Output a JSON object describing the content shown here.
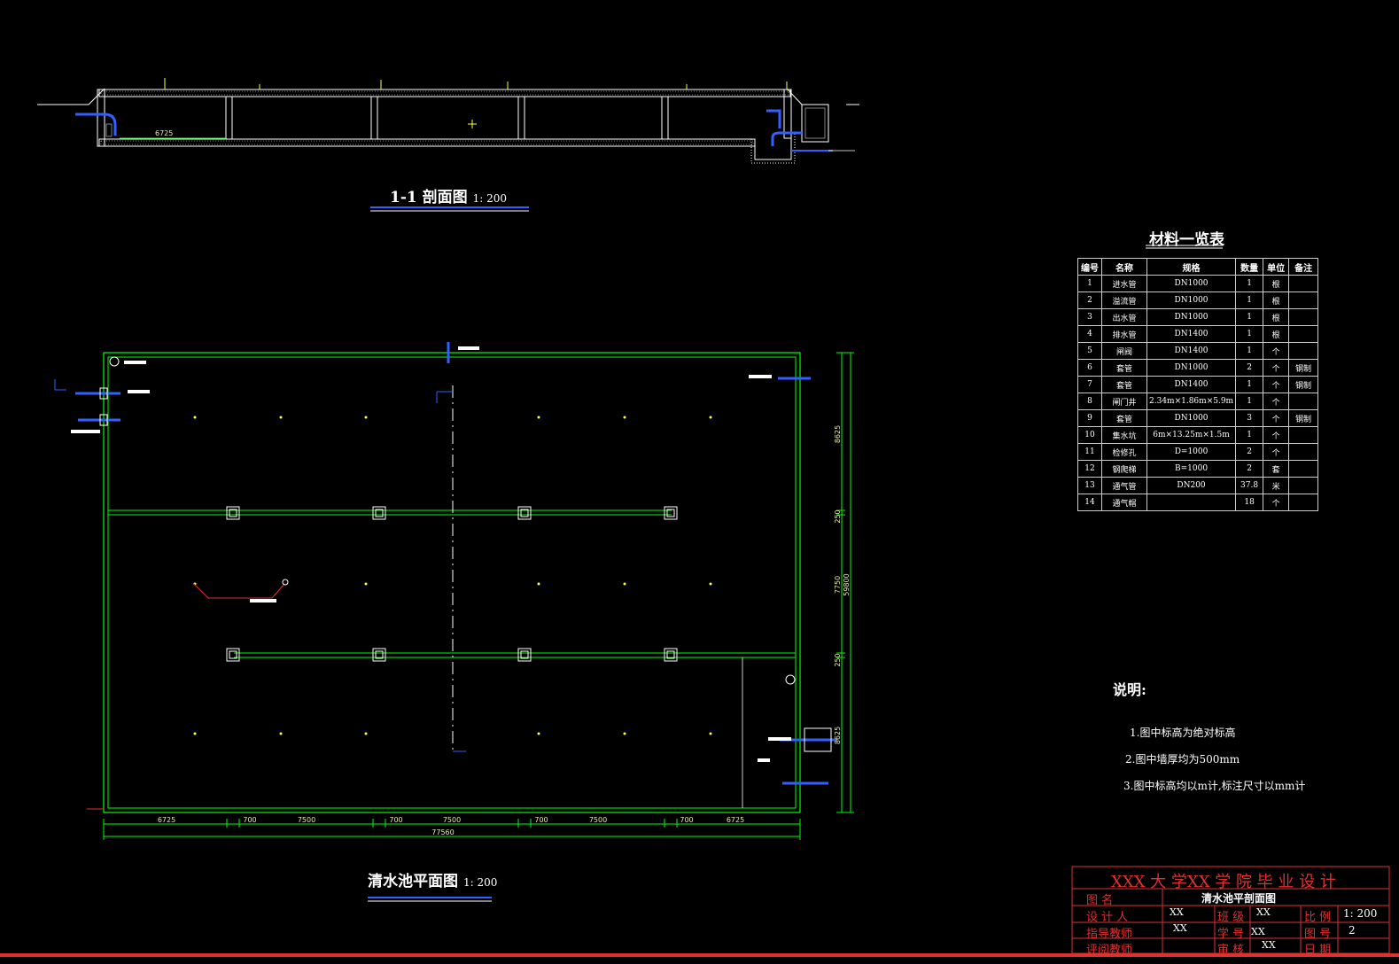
{
  "section_view": {
    "title": "1-1 剖面图",
    "scale": "1: 200",
    "dim_left": "6725"
  },
  "plan_view": {
    "title": "清水池平面图",
    "scale": "1: 200",
    "dims_bottom": [
      "6725",
      "700",
      "7500",
      "700",
      "7500",
      "700",
      "7500",
      "700",
      "6725"
    ],
    "dim_total_bottom": "77560",
    "dims_right": [
      "8625",
      "250",
      "7750",
      "250",
      "8625"
    ],
    "dim_total_right": "59800"
  },
  "materials": {
    "title": "材料一览表",
    "headers": [
      "编号",
      "名称",
      "规格",
      "数量",
      "单位",
      "备注"
    ],
    "rows": [
      [
        "1",
        "进水管",
        "DN1000",
        "1",
        "根",
        ""
      ],
      [
        "2",
        "溢流管",
        "DN1000",
        "1",
        "根",
        ""
      ],
      [
        "3",
        "出水管",
        "DN1000",
        "1",
        "根",
        ""
      ],
      [
        "4",
        "排水管",
        "DN1400",
        "1",
        "根",
        ""
      ],
      [
        "5",
        "闸阀",
        "DN1400",
        "1",
        "个",
        ""
      ],
      [
        "6",
        "套管",
        "DN1000",
        "2",
        "个",
        "钢制"
      ],
      [
        "7",
        "套管",
        "DN1400",
        "1",
        "个",
        "钢制"
      ],
      [
        "8",
        "闸门井",
        "2.34m×1.86m×5.9m",
        "1",
        "个",
        ""
      ],
      [
        "9",
        "套管",
        "DN1000",
        "3",
        "个",
        "钢制"
      ],
      [
        "10",
        "集水坑",
        "6m×13.25m×1.5m",
        "1",
        "个",
        ""
      ],
      [
        "11",
        "检修孔",
        "D=1000",
        "2",
        "个",
        ""
      ],
      [
        "12",
        "钢爬梯",
        "B=1000",
        "2",
        "套",
        ""
      ],
      [
        "13",
        "通气管",
        "DN200",
        "37.8",
        "米",
        ""
      ],
      [
        "14",
        "通气帽",
        "",
        "18",
        "个",
        ""
      ]
    ]
  },
  "notes": {
    "heading": "说明:",
    "items": [
      "1.图中标高为绝对标高",
      "2.图中墙厚均为500mm",
      "3.图中标高均以m计,标注尺寸以mm计"
    ]
  },
  "title_block": {
    "school": "XXX 大 学XX 学 院 毕 业 设 计",
    "drawing_name_label": "图    名",
    "drawing_name": "清水池平剖面图",
    "designer_label": "设 计 人",
    "designer": "XX",
    "class_label": "班 级",
    "class": "XX",
    "scale_label": "比 例",
    "scale": "1: 200",
    "advisor_label": "指导教师",
    "advisor": "XX",
    "student_no_label": "学 号",
    "student_no": "XX",
    "drawing_no_label": "图 号",
    "drawing_no": "2",
    "reviewer_label": "评阅教师",
    "checker_label": "审 核",
    "checker": "XX",
    "date_label": "日 期"
  },
  "colors": {
    "background": "#000000",
    "wall": "#00ff00",
    "pipe": "#3060ff",
    "dimension": "#00ff00",
    "title_red": "#e03030",
    "column_yellow": "#ffff40"
  }
}
